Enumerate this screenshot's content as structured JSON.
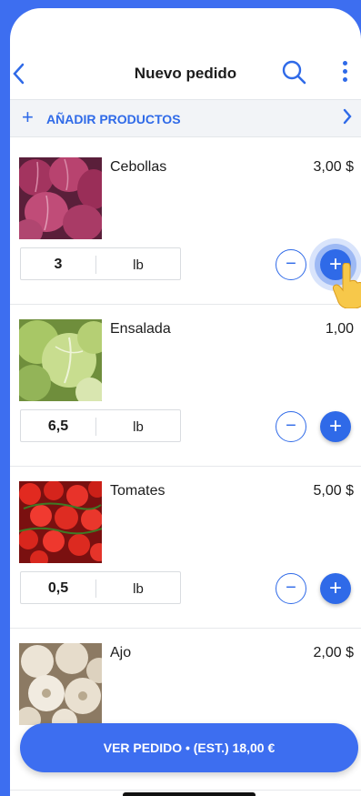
{
  "header": {
    "back_label": "<",
    "title": "Nuevo pedido"
  },
  "add_products": {
    "label": "AÑADIR PRODUCTOS",
    "plus": "+",
    "chevron": "›"
  },
  "items": [
    {
      "name": "Cebollas",
      "price": "3,00 $",
      "qty": "3",
      "unit": "lb",
      "minus": "−",
      "plus": "+"
    },
    {
      "name": "Ensalada",
      "price": "1,00",
      "qty": "6,5",
      "unit": "lb",
      "minus": "−",
      "plus": "+"
    },
    {
      "name": "Tomates",
      "price": "5,00 $",
      "qty": "0,5",
      "unit": "lb",
      "minus": "−",
      "plus": "+"
    },
    {
      "name": "Ajo",
      "price": "2,00 $"
    }
  ],
  "cta": {
    "label": "VER PEDIDO • (EST.) 18,00 €"
  },
  "colors": {
    "accent": "#2f6ae8",
    "background": "#3d6ef0"
  }
}
